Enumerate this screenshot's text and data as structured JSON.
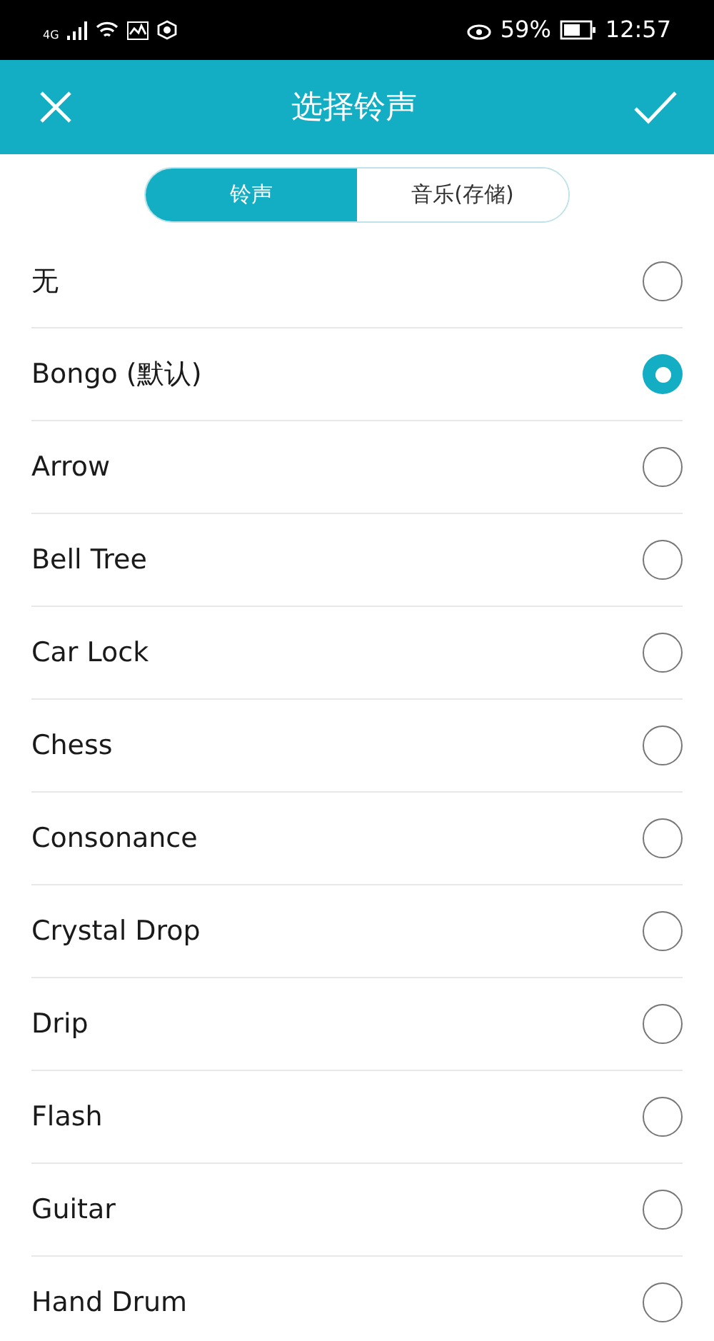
{
  "status_bar": {
    "network": "4G",
    "battery": "59%",
    "time": "12:57"
  },
  "header": {
    "title": "选择铃声"
  },
  "tabs": [
    {
      "label": "铃声",
      "selected": true
    },
    {
      "label": "音乐(存储)",
      "selected": false
    }
  ],
  "ringtones": [
    {
      "name": "无",
      "selected": false
    },
    {
      "name": "Bongo (默认)",
      "selected": true
    },
    {
      "name": "Arrow",
      "selected": false
    },
    {
      "name": "Bell Tree",
      "selected": false
    },
    {
      "name": "Car Lock",
      "selected": false
    },
    {
      "name": "Chess",
      "selected": false
    },
    {
      "name": "Consonance",
      "selected": false
    },
    {
      "name": "Crystal Drop",
      "selected": false
    },
    {
      "name": "Drip",
      "selected": false
    },
    {
      "name": "Flash",
      "selected": false
    },
    {
      "name": "Guitar",
      "selected": false
    },
    {
      "name": "Hand Drum",
      "selected": false
    }
  ]
}
